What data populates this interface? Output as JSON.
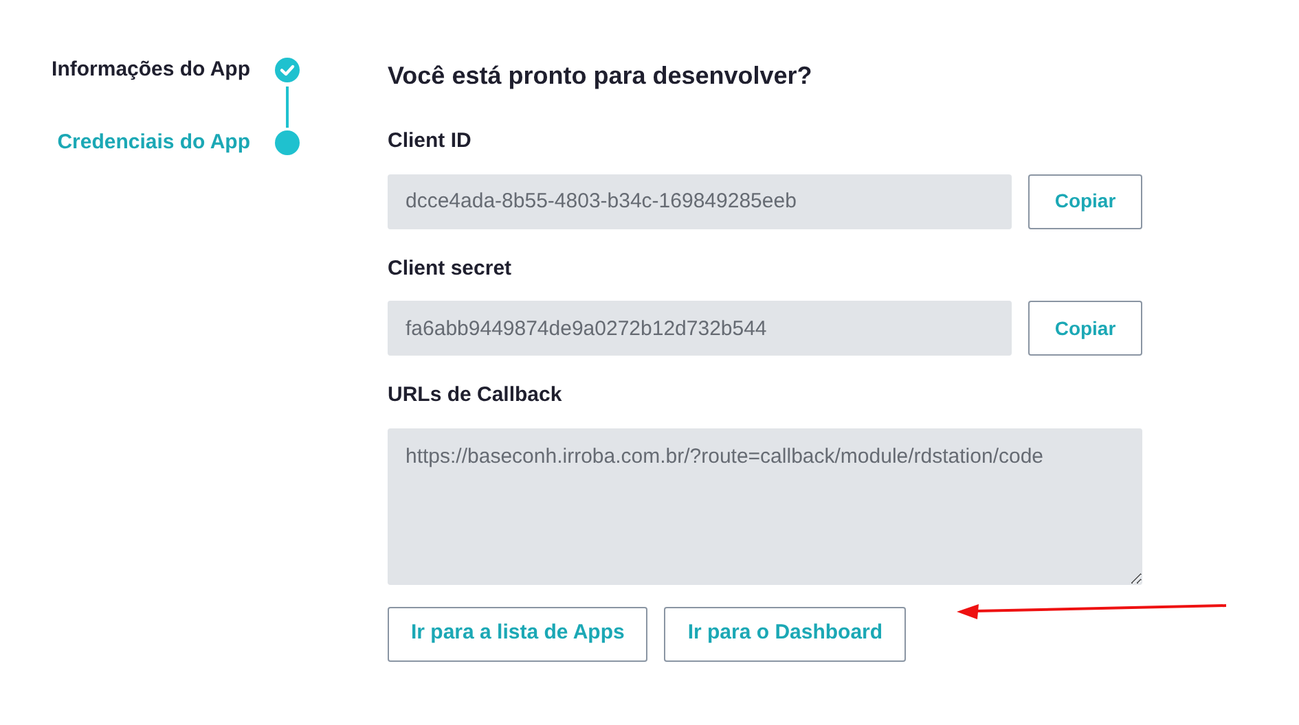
{
  "stepper": [
    {
      "label": "Informações do App",
      "completed": true,
      "selected": false
    },
    {
      "label": "Credenciais do App",
      "completed": false,
      "selected": true
    }
  ],
  "heading": "Você está pronto para desenvolver?",
  "fields": [
    {
      "label": "Client ID",
      "value": "dcce4ada-8b55-4803-b34c-169849285eeb",
      "button": "Copiar"
    },
    {
      "label": "Client secret",
      "value": "fa6abb9449874de9a0272b12d732b544",
      "button": "Copiar"
    }
  ],
  "callback": {
    "label": "URLs de Callback",
    "value": "https://baseconh.irroba.com.br/?route=callback/module/rdstation/code"
  },
  "buttons": [
    "Ir para a lista de Apps",
    "Ir para o Dashboard"
  ]
}
